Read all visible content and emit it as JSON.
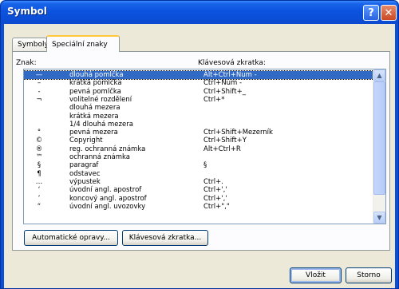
{
  "window": {
    "title": "Symbol"
  },
  "tabs": [
    {
      "label": "Symboly"
    },
    {
      "label": "Speciální znaky"
    }
  ],
  "columns": {
    "char": "Znak:",
    "shortcut": "Klávesová zkratka:"
  },
  "rows": [
    {
      "symbol": "—",
      "name": "dlouhá pomlčka",
      "shortcut": "Alt+Ctrl+Num -"
    },
    {
      "symbol": "–",
      "name": "krátká pomlčka",
      "shortcut": "Ctrl+Num -"
    },
    {
      "symbol": "-",
      "name": "pevná pomlčka",
      "shortcut": "Ctrl+Shift+_"
    },
    {
      "symbol": "¬",
      "name": "volitelné rozdělení",
      "shortcut": "Ctrl+*"
    },
    {
      "symbol": "",
      "name": "dlouhá mezera",
      "shortcut": ""
    },
    {
      "symbol": "",
      "name": "krátká mezera",
      "shortcut": ""
    },
    {
      "symbol": "",
      "name": "1/4 dlouhá mezera",
      "shortcut": ""
    },
    {
      "symbol": "°",
      "name": "pevná mezera",
      "shortcut": "Ctrl+Shift+Mezerník"
    },
    {
      "symbol": "©",
      "name": "Copyright",
      "shortcut": "Ctrl+Shift+Y"
    },
    {
      "symbol": "®",
      "name": "reg. ochranná známka",
      "shortcut": "Alt+Ctrl+R"
    },
    {
      "symbol": "™",
      "name": "ochranná známka",
      "shortcut": ""
    },
    {
      "symbol": "§",
      "name": "paragraf",
      "shortcut": "§"
    },
    {
      "symbol": "¶",
      "name": "odstavec",
      "shortcut": ""
    },
    {
      "symbol": "…",
      "name": "výpustek",
      "shortcut": "Ctrl+."
    },
    {
      "symbol": "‘",
      "name": "úvodní angl. apostrof",
      "shortcut": "Ctrl+','"
    },
    {
      "symbol": "’",
      "name": "koncový angl. apostrof",
      "shortcut": "Ctrl+','"
    },
    {
      "symbol": "“",
      "name": "úvodní angl. uvozovky",
      "shortcut": "Ctrl+\",\""
    }
  ],
  "selected_row": 0,
  "buttons": {
    "autocorrect": "Automatické opravy...",
    "shortcut_key": "Klávesová zkratka...",
    "insert": "Vložit",
    "cancel": "Storno"
  },
  "icons": {
    "help": "?",
    "close": "✕",
    "scroll_up": "▲",
    "scroll_down": "▼"
  }
}
